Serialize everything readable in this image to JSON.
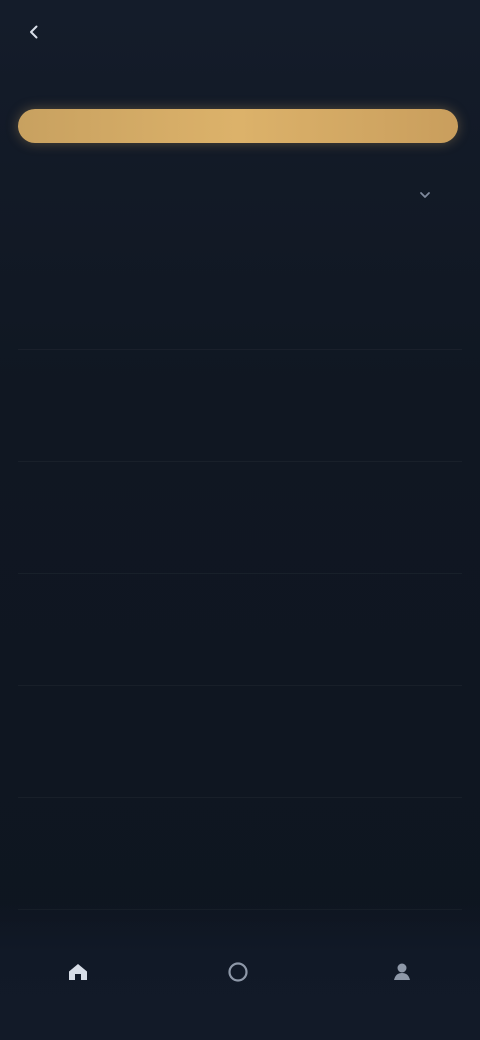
{
  "header": {
    "left_label": "",
    "right_label": "",
    "title": ""
  },
  "banner": {
    "text": ""
  },
  "info": {
    "title": "",
    "subtitle": ""
  },
  "rows": [
    {
      "name": "",
      "link": "",
      "status": "",
      "value": "",
      "status_color": "#c7a86b"
    },
    {
      "name": "",
      "link": "",
      "status": "",
      "value": "",
      "status_color": "#7fae63"
    },
    {
      "name": "",
      "link": "",
      "status": "",
      "value": "",
      "status_color": "#7fae63"
    },
    {
      "name": "",
      "link": "",
      "status": "",
      "value": "",
      "status_color": "#7fae63"
    },
    {
      "name": "",
      "link": "",
      "status": "",
      "value": "",
      "status_color": "#c7a86b"
    },
    {
      "name": "",
      "link": "",
      "status": "",
      "value": "",
      "status_color": "#c7a86b"
    }
  ],
  "icons": {
    "back": "chevron-left-icon",
    "info_action": "chevron-down-icon",
    "nav_home": "home-icon",
    "nav_mid": "circle-icon",
    "nav_right": "person-icon"
  },
  "colors": {
    "banner_gold": "#d6ad67",
    "link_blue": "#4d77c8",
    "status_green": "#7fae63",
    "status_gold": "#c7a86b"
  }
}
